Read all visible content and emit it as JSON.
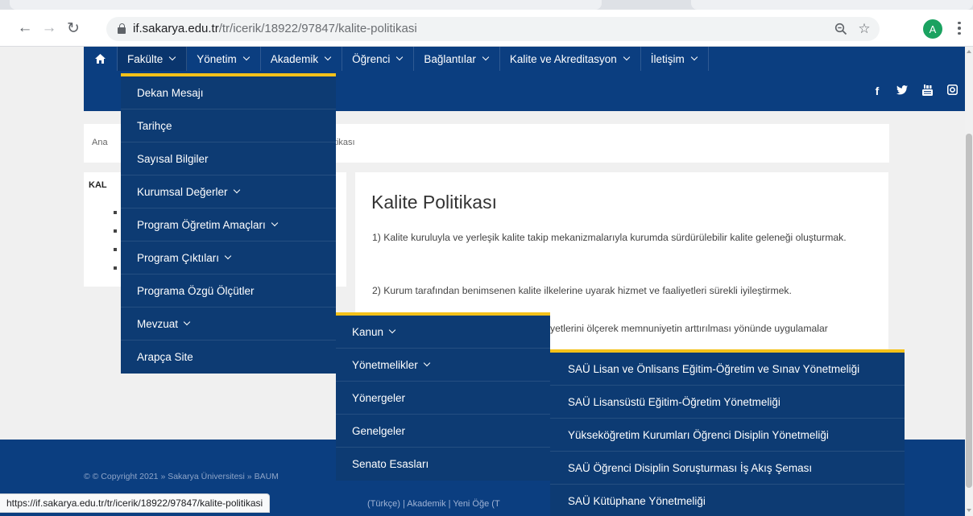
{
  "browser": {
    "url_host": "if.sakarya.edu.tr",
    "url_path": "/tr/icerik/18922/97847/kalite-politikasi",
    "avatar_letter": "A",
    "status_url": "https://if.sakarya.edu.tr/tr/icerik/18922/97847/kalite-politikasi"
  },
  "nav": {
    "items": [
      "Fakülte",
      "Yönetim",
      "Akademik",
      "Öğrenci",
      "Bağlantılar",
      "Kalite ve Akreditasyon",
      "İletişim"
    ]
  },
  "social": [
    "f",
    "t",
    "yt",
    "ig"
  ],
  "breadcrumb": {
    "start": "Ana",
    "end": "litikası"
  },
  "sidebar": {
    "title": "KAL"
  },
  "content": {
    "title": "Kalite Politikası",
    "p1": "1) Kalite kuruluyla ve yerleşik kalite takip mekanizmalarıyla kurumda sürdürülebilir kalite geleneği oluşturmak.",
    "p2": "2) Kurum tarafından benimsenen kalite ilkelerine uyarak hizmet ve faaliyetleri sürekli iyileştirmek.",
    "p3": "yetlerini ölçerek memnuniyetin arttırılması yönünde uygulamalar"
  },
  "dropdown_fakulte": [
    {
      "label": "Dekan Mesajı",
      "sub": false
    },
    {
      "label": "Tarihçe",
      "sub": false
    },
    {
      "label": "Sayısal Bilgiler",
      "sub": false
    },
    {
      "label": "Kurumsal Değerler",
      "sub": true
    },
    {
      "label": "Program Öğretim Amaçları",
      "sub": true
    },
    {
      "label": "Program Çıktıları",
      "sub": true
    },
    {
      "label": "Programa Özgü Ölçütler",
      "sub": false
    },
    {
      "label": "Mevzuat",
      "sub": true
    },
    {
      "label": "Arapça Site",
      "sub": false
    }
  ],
  "dropdown_mevzuat": [
    {
      "label": "Kanun",
      "sub": true
    },
    {
      "label": "Yönetmelikler",
      "sub": true
    },
    {
      "label": "Yönergeler",
      "sub": false
    },
    {
      "label": "Genelgeler",
      "sub": false
    },
    {
      "label": "Senato Esasları",
      "sub": false
    }
  ],
  "dropdown_yonetmelikler": [
    {
      "label": "SAÜ Lisan ve Önlisans Eğitim-Öğretim ve Sınav Yönetmeliği"
    },
    {
      "label": "SAÜ Lisansüstü Eğitim-Öğretim Yönetmeliği"
    },
    {
      "label": "Yükseköğretim Kurumları Öğrenci Disiplin Yönetmeliği"
    },
    {
      "label": "SAÜ Öğrenci Disiplin Soruşturması İş Akış Şeması"
    },
    {
      "label": "SAÜ Kütüphane Yönetmeliği"
    }
  ],
  "footer": {
    "copyright": "© © Copyright 2021 » Sakarya Üniversitesi » BAUM",
    "links": "(Türkçe)  |  Akademik  |  Yeni Öğe (T"
  }
}
